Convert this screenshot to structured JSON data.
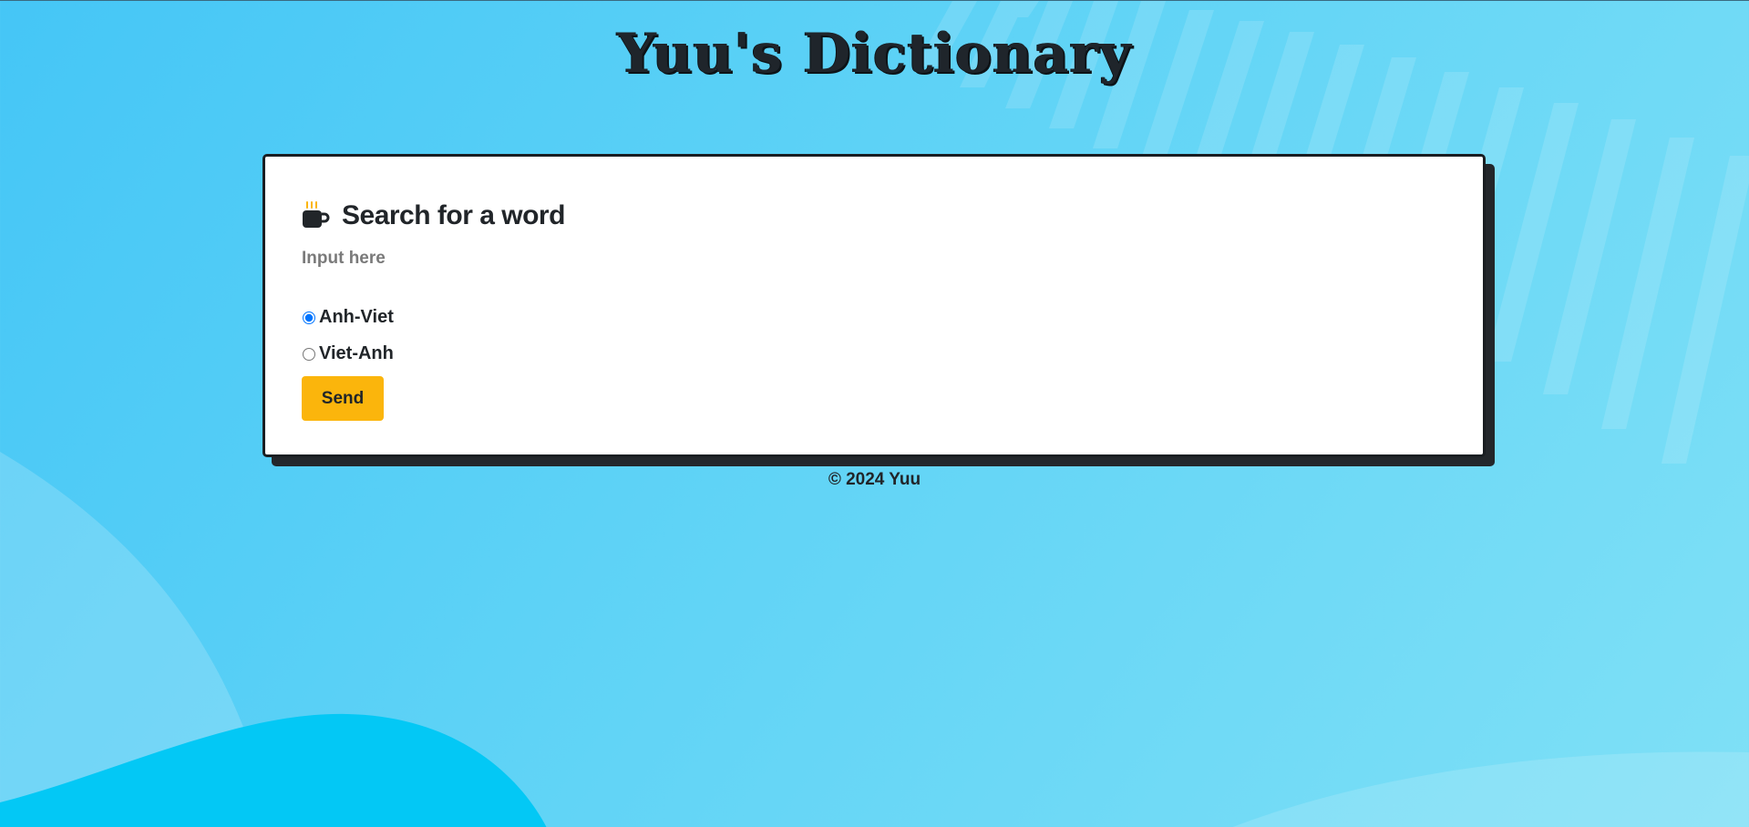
{
  "site": {
    "title": "Yuu's Dictionary"
  },
  "search_card": {
    "icon": "coffee-mug-icon",
    "heading": "Search for a word",
    "input": {
      "placeholder": "Input here",
      "value": ""
    },
    "options": [
      {
        "label": "Anh-Viet",
        "selected": true
      },
      {
        "label": "Viet-Anh",
        "selected": false
      }
    ],
    "send_label": "Send"
  },
  "footer": {
    "text": "© 2024 Yuu"
  },
  "colors": {
    "background": "#5fd3f6",
    "card": "#ffffff",
    "card_shadow": "#23272b",
    "send_button": "#fbb50c",
    "text": "#212529",
    "mug_steam": "#fbb50c"
  }
}
